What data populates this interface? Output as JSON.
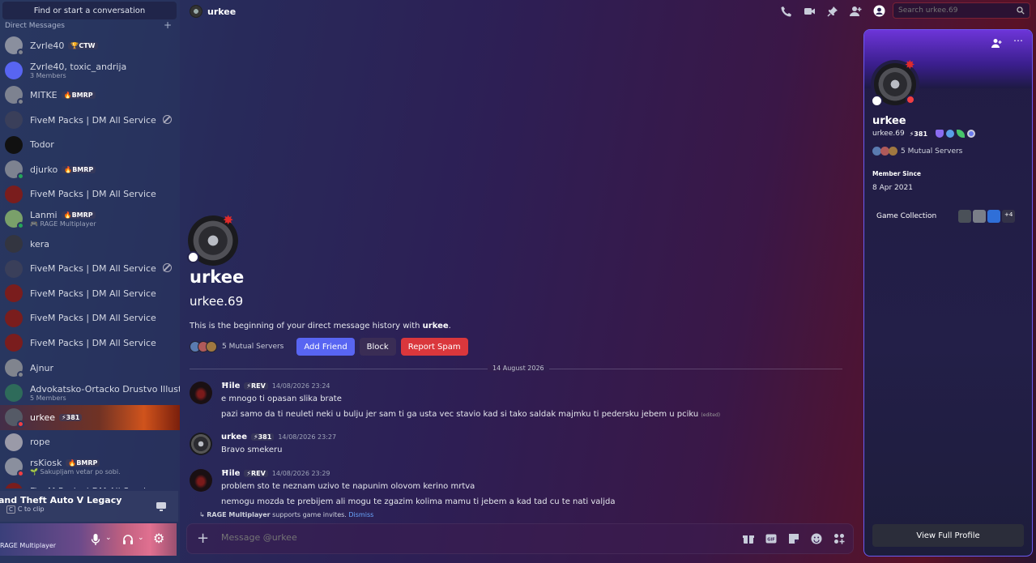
{
  "sidebar": {
    "search_label": "Find or start a conversation",
    "dm_header": "Direct Messages",
    "add": "+",
    "items": [
      {
        "name": "Zvrle40",
        "tag": "🏆CTW",
        "sub": "",
        "status": "off",
        "color": "#8a8f9e"
      },
      {
        "name": "Zvrle40, toxic_andrija",
        "tag": "",
        "sub": "3 Members",
        "status": "",
        "color": "#5865f2"
      },
      {
        "name": "MITKE",
        "tag": "🔥BMRP",
        "sub": "",
        "status": "off",
        "color": "#7d8290"
      },
      {
        "name": "FiveM Packs | DM All Service",
        "tag": "",
        "sub": "",
        "status": "",
        "color": "#3a3f5a",
        "blocked": true
      },
      {
        "name": "Todor",
        "tag": "",
        "sub": "",
        "status": "",
        "color": "#111111"
      },
      {
        "name": "djurko",
        "tag": "🔥BMRP",
        "sub": "",
        "status": "on",
        "color": "#7d8290"
      },
      {
        "name": "FiveM Packs | DM All Service",
        "tag": "",
        "sub": "",
        "status": "",
        "color": "#7a1d1d"
      },
      {
        "name": "Lanmi",
        "tag": "🔥BMRP",
        "sub": "🎮 RAGE Multiplayer",
        "status": "on",
        "color": "#7aa06a"
      },
      {
        "name": "kera",
        "tag": "",
        "sub": "",
        "status": "",
        "color": "#333540"
      },
      {
        "name": "FiveM Packs | DM All Service",
        "tag": "",
        "sub": "",
        "status": "",
        "color": "#3a3f5a",
        "blocked": true
      },
      {
        "name": "FiveM Packs | DM All Service",
        "tag": "",
        "sub": "",
        "status": "",
        "color": "#7a1d1d"
      },
      {
        "name": "FiveM Packs | DM All Service",
        "tag": "",
        "sub": "",
        "status": "",
        "color": "#7a1d1d"
      },
      {
        "name": "FiveM Packs | DM All Service",
        "tag": "",
        "sub": "",
        "status": "",
        "color": "#7a1d1d"
      },
      {
        "name": "Ajnur",
        "tag": "",
        "sub": "",
        "status": "off",
        "color": "#80848e"
      },
      {
        "name": "Advokatsko-Ortacko Drustvo Illustia",
        "tag": "",
        "sub": "5 Members",
        "status": "",
        "color": "#2e6b5a"
      },
      {
        "name": "urkee",
        "tag": "⚡381",
        "sub": "",
        "status": "dnd",
        "color": "#555a66",
        "active": true
      },
      {
        "name": "rope",
        "tag": "",
        "sub": "",
        "status": "",
        "color": "#9a9aa8"
      },
      {
        "name": "rsKiosk",
        "tag": "🔥BMRP",
        "sub": "🌱 Sakupljam vetar po sobi.",
        "status": "dnd",
        "color": "#8a8f9e"
      },
      {
        "name": "FiveM Packs | DM All Service",
        "tag": "",
        "sub": "",
        "status": "",
        "color": "#7a1d1d"
      }
    ],
    "game_title": "and Theft Auto V Legacy",
    "game_hint": "C to clip",
    "user_sub": "RAGE Multiplayer"
  },
  "topbar": {
    "title": "urkee",
    "search_placeholder": "Search urkee.69"
  },
  "intro": {
    "display_name": "urkee",
    "username": "urkee.69",
    "begin_prefix": "This is the beginning of your direct message history with ",
    "begin_name": "urkee",
    "begin_suffix": ".",
    "mutual": "5 Mutual Servers",
    "add_friend": "Add Friend",
    "block": "Block",
    "report": "Report Spam"
  },
  "divider_date": "14 August 2026",
  "messages": [
    {
      "author": "Ħile",
      "badge": "⚡REV",
      "time": "14/08/2026 23:24",
      "lines": [
        "e mnogo ti opasan slika brate",
        "pazi samo da ti neuleti neki u bulju jer sam ti ga usta vec stavio kad si tako saldak majmku ti pedersku jebem u pciku"
      ],
      "edited": "(edited)"
    },
    {
      "author": "urkee",
      "badge": "⚡381",
      "time": "14/08/2026 23:27",
      "lines": [
        "Bravo smekeru"
      ],
      "edited": ""
    },
    {
      "author": "Ħile",
      "badge": "⚡REV",
      "time": "14/08/2026 23:29",
      "lines": [
        "problem sto te neznam uzivo te napunim olovom kerino mrtva",
        "nemogu mozda te prebijem ali mogu te zgazim kolima mamu ti jebem a kad tad cu te nati valjda"
      ],
      "edited": ""
    }
  ],
  "invite": {
    "game": "RAGE Multiplayer",
    "text": " supports game invites. ",
    "dismiss": "Dismiss"
  },
  "composer": {
    "placeholder": "Message @urkee"
  },
  "profile": {
    "display_name": "urkee",
    "username": "urkee.69",
    "boost": "⚡381",
    "mutual": "5 Mutual Servers",
    "member_since_label": "Member Since",
    "member_since": "8 Apr 2021",
    "game_collection": "Game Collection",
    "more_games": "+4",
    "view_full": "View Full Profile"
  },
  "colors": {
    "accent": "#5865f2",
    "danger": "#da373c",
    "online": "#23a55a",
    "dnd": "#f23f43"
  }
}
